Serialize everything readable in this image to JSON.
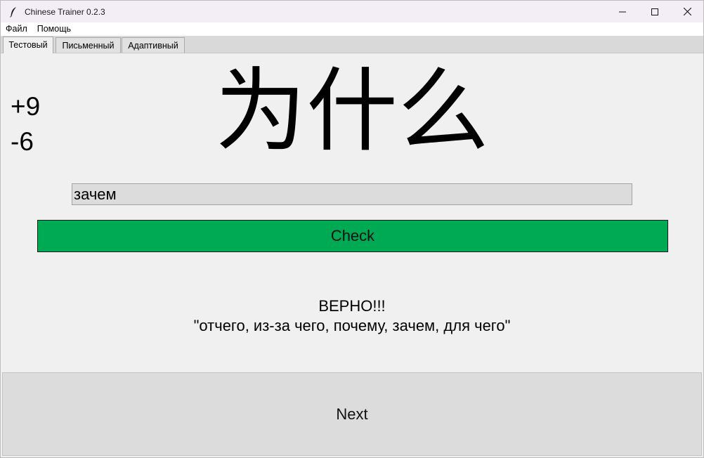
{
  "window": {
    "title": "Chinese Trainer 0.2.3",
    "icon": "feather-icon"
  },
  "menu": {
    "items": [
      {
        "label": "Файл"
      },
      {
        "label": "Помощь"
      }
    ]
  },
  "tabs": [
    {
      "label": "Тестовый",
      "active": true
    },
    {
      "label": "Письменный",
      "active": false
    },
    {
      "label": "Адаптивный",
      "active": false
    }
  ],
  "score": {
    "correct": "+9",
    "wrong": "-6"
  },
  "question": {
    "hanzi": "为什么"
  },
  "answer": {
    "value": "зачем",
    "placeholder": ""
  },
  "buttons": {
    "check_label": "Check",
    "next_label": "Next"
  },
  "result": {
    "status": "ВЕРНО!!!",
    "translations": "\"отчего, из-за чего, почему, зачем, для чего\""
  },
  "colors": {
    "check_button": "#00a953",
    "next_button": "#dcdcdc",
    "background": "#f0f0f0"
  }
}
